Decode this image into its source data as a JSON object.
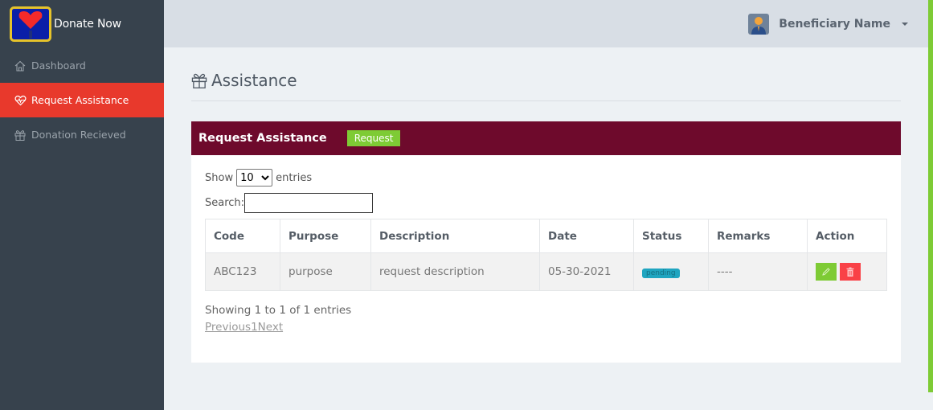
{
  "brand": {
    "name": "Donate Now",
    "logo_icon": "heart-hands-logo"
  },
  "sidebar": {
    "items": [
      {
        "label": "Dashboard",
        "icon": "home-icon",
        "active": false
      },
      {
        "label": "Request Assistance",
        "icon": "heartbeat-icon",
        "active": true
      },
      {
        "label": "Donation Recieved",
        "icon": "gift-icon",
        "active": false
      }
    ]
  },
  "topbar": {
    "user_name": "Beneficiary Name",
    "avatar_icon": "user-avatar"
  },
  "page": {
    "title": "Assistance",
    "title_icon": "gift-icon"
  },
  "card": {
    "title": "Request Assistance",
    "request_button": "Request",
    "show_label": "Show",
    "entries_label": "entries",
    "page_length": "10",
    "page_length_options": [
      "10"
    ],
    "search_label": "Search:",
    "search_value": ""
  },
  "table": {
    "columns": [
      "Code",
      "Purpose",
      "Description",
      "Date",
      "Status",
      "Remarks",
      "Action"
    ],
    "rows": [
      {
        "code": "ABC123",
        "purpose": "purpose",
        "description": "request description",
        "date": "05-30-2021",
        "status": "pending",
        "remarks": "----"
      }
    ]
  },
  "footer": {
    "info": "Showing 1 to 1 of 1 entries",
    "previous": "Previous",
    "page": "1",
    "next": "Next"
  },
  "colors": {
    "sidebar": "#37424d",
    "active": "#e8392c",
    "card_header": "#6e0a2c",
    "green": "#7ecb35",
    "danger": "#f94147",
    "info": "#1fa5c0"
  }
}
